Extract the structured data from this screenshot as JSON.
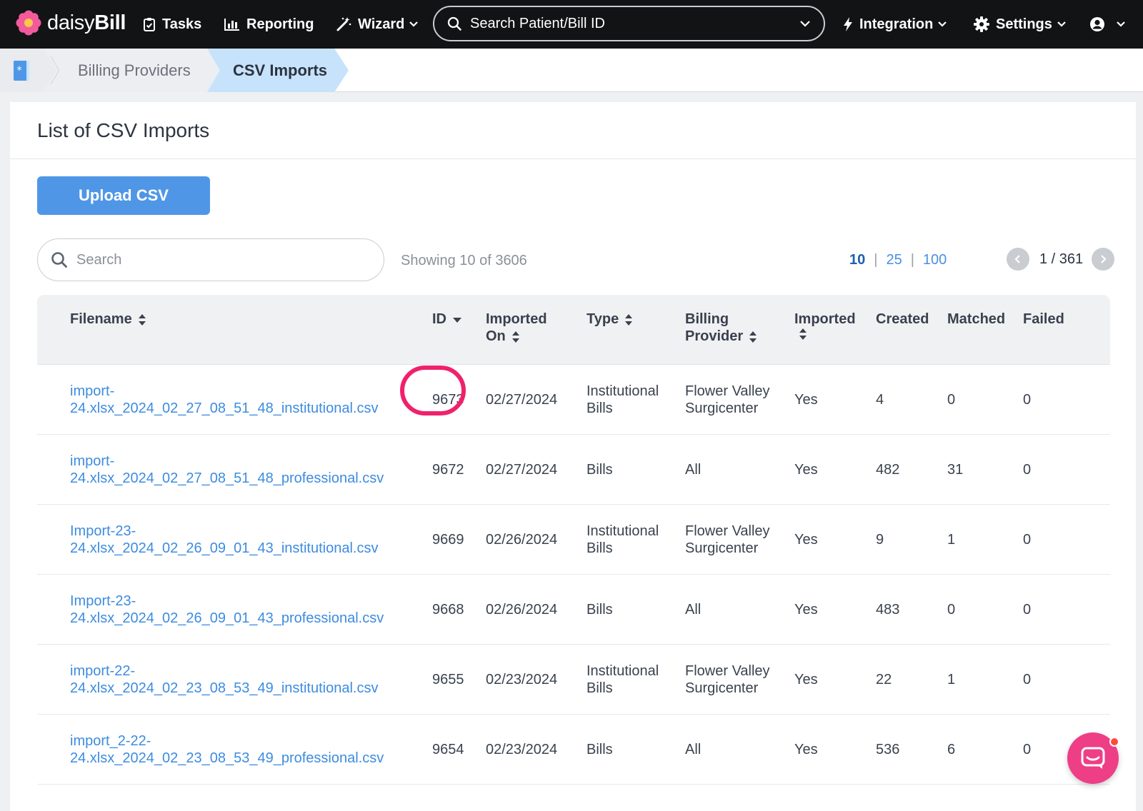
{
  "brand": {
    "light": "daisy",
    "bold": "Bill"
  },
  "nav": {
    "tasks": "Tasks",
    "reporting": "Reporting",
    "wizard": "Wizard",
    "search_placeholder": "Search Patient/Bill ID",
    "integration": "Integration",
    "settings": "Settings"
  },
  "breadcrumb": {
    "billing_providers": "Billing Providers",
    "csv_imports": "CSV Imports"
  },
  "page": {
    "title": "List of CSV Imports",
    "upload_label": "Upload CSV",
    "search_placeholder": "Search",
    "showing": "Showing 10 of 3606",
    "page_sizes": [
      "10",
      "25",
      "100"
    ],
    "page_info": "1 / 361"
  },
  "table": {
    "headers": {
      "filename": "Filename",
      "id": "ID",
      "imported_on_1": "Imported",
      "imported_on_2": "On",
      "type": "Type",
      "billing_provider_1": "Billing",
      "billing_provider_2": "Provider",
      "imported": "Imported",
      "created": "Created",
      "matched": "Matched",
      "failed": "Failed"
    },
    "rows": [
      {
        "filename_1": "import-",
        "filename_2": "24.xlsx_2024_02_27_08_51_48_institutional.csv",
        "id": "9673",
        "imported_on": "02/27/2024",
        "type_1": "Institutional",
        "type_2": "Bills",
        "provider_1": "Flower Valley",
        "provider_2": "Surgicenter",
        "imported": "Yes",
        "created": "4",
        "matched": "0",
        "failed": "0"
      },
      {
        "filename_1": "import-",
        "filename_2": "24.xlsx_2024_02_27_08_51_48_professional.csv",
        "id": "9672",
        "imported_on": "02/27/2024",
        "type_1": "Bills",
        "type_2": "",
        "provider_1": "All",
        "provider_2": "",
        "imported": "Yes",
        "created": "482",
        "matched": "31",
        "failed": "0"
      },
      {
        "filename_1": "Import-23-",
        "filename_2": "24.xlsx_2024_02_26_09_01_43_institutional.csv",
        "id": "9669",
        "imported_on": "02/26/2024",
        "type_1": "Institutional",
        "type_2": "Bills",
        "provider_1": "Flower Valley",
        "provider_2": "Surgicenter",
        "imported": "Yes",
        "created": "9",
        "matched": "1",
        "failed": "0"
      },
      {
        "filename_1": "Import-23-",
        "filename_2": "24.xlsx_2024_02_26_09_01_43_professional.csv",
        "id": "9668",
        "imported_on": "02/26/2024",
        "type_1": "Bills",
        "type_2": "",
        "provider_1": "All",
        "provider_2": "",
        "imported": "Yes",
        "created": "483",
        "matched": "0",
        "failed": "0"
      },
      {
        "filename_1": "import-22-",
        "filename_2": "24.xlsx_2024_02_23_08_53_49_institutional.csv",
        "id": "9655",
        "imported_on": "02/23/2024",
        "type_1": "Institutional",
        "type_2": "Bills",
        "provider_1": "Flower Valley",
        "provider_2": "Surgicenter",
        "imported": "Yes",
        "created": "22",
        "matched": "1",
        "failed": "0"
      },
      {
        "filename_1": "import_2-22-",
        "filename_2": "24.xlsx_2024_02_23_08_53_49_professional.csv",
        "id": "9654",
        "imported_on": "02/23/2024",
        "type_1": "Bills",
        "type_2": "",
        "provider_1": "All",
        "provider_2": "",
        "imported": "Yes",
        "created": "536",
        "matched": "6",
        "failed": "0"
      }
    ]
  },
  "colors": {
    "accent": "#4f97e6",
    "link": "#3d8ce0",
    "highlight": "#f0216b",
    "chat": "#ee3e86",
    "nav_bg": "#111315"
  }
}
